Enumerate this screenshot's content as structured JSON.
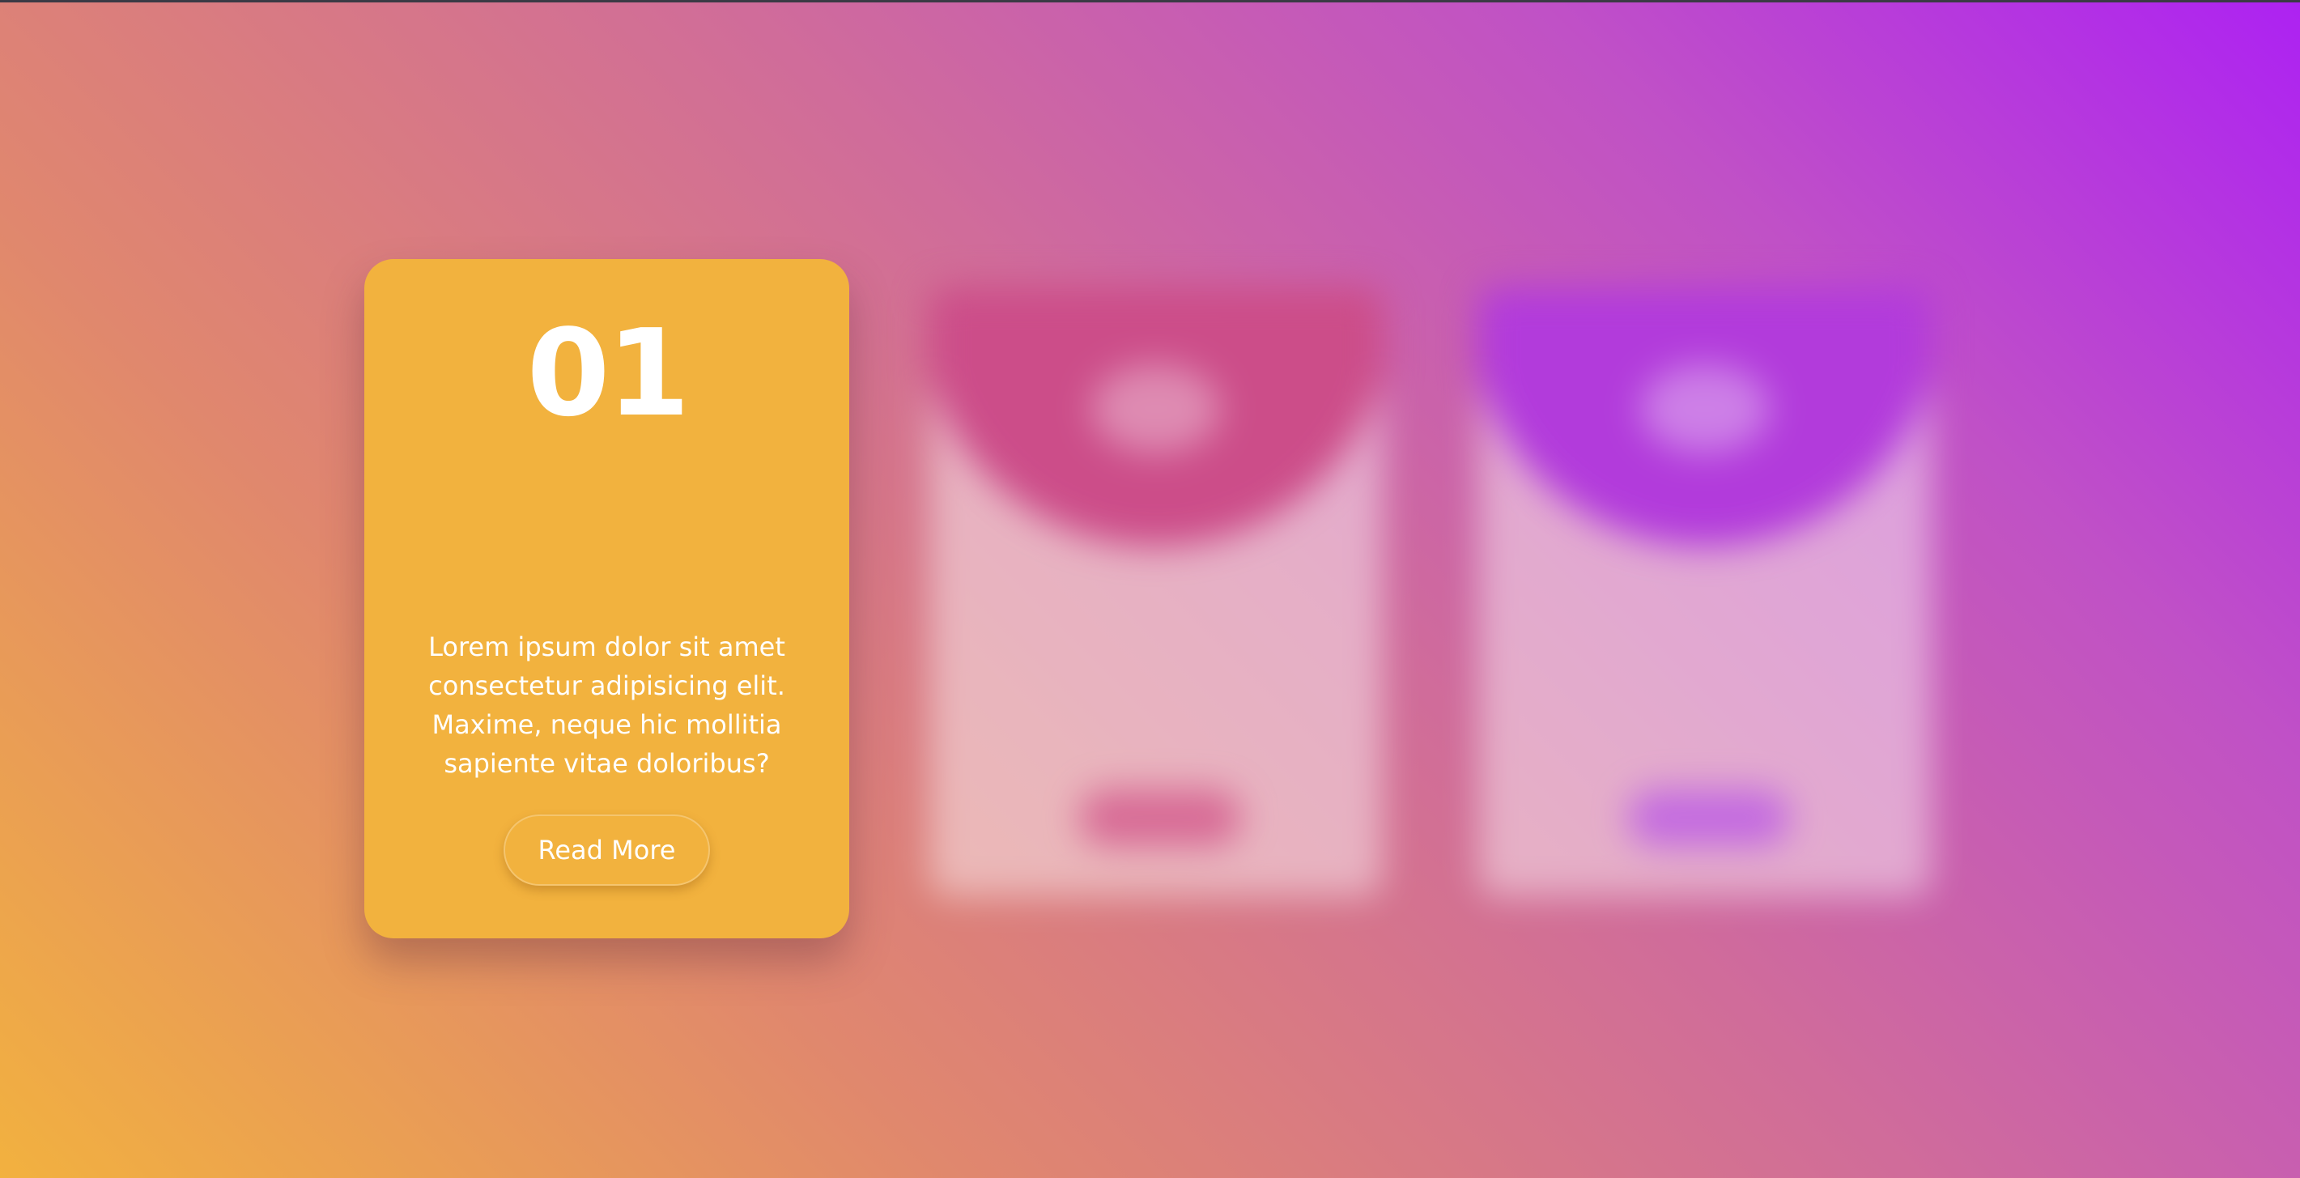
{
  "cards": [
    {
      "number": "01",
      "description": "Lorem ipsum dolor sit amet consectetur adipisicing elit. Maxime, neque hic mollitia sapiente vitae doloribus?",
      "button_label": "Read More",
      "accent": "#f2b23e"
    },
    {
      "accent": "#cc4d89"
    },
    {
      "accent": "#b23bdb"
    }
  ]
}
